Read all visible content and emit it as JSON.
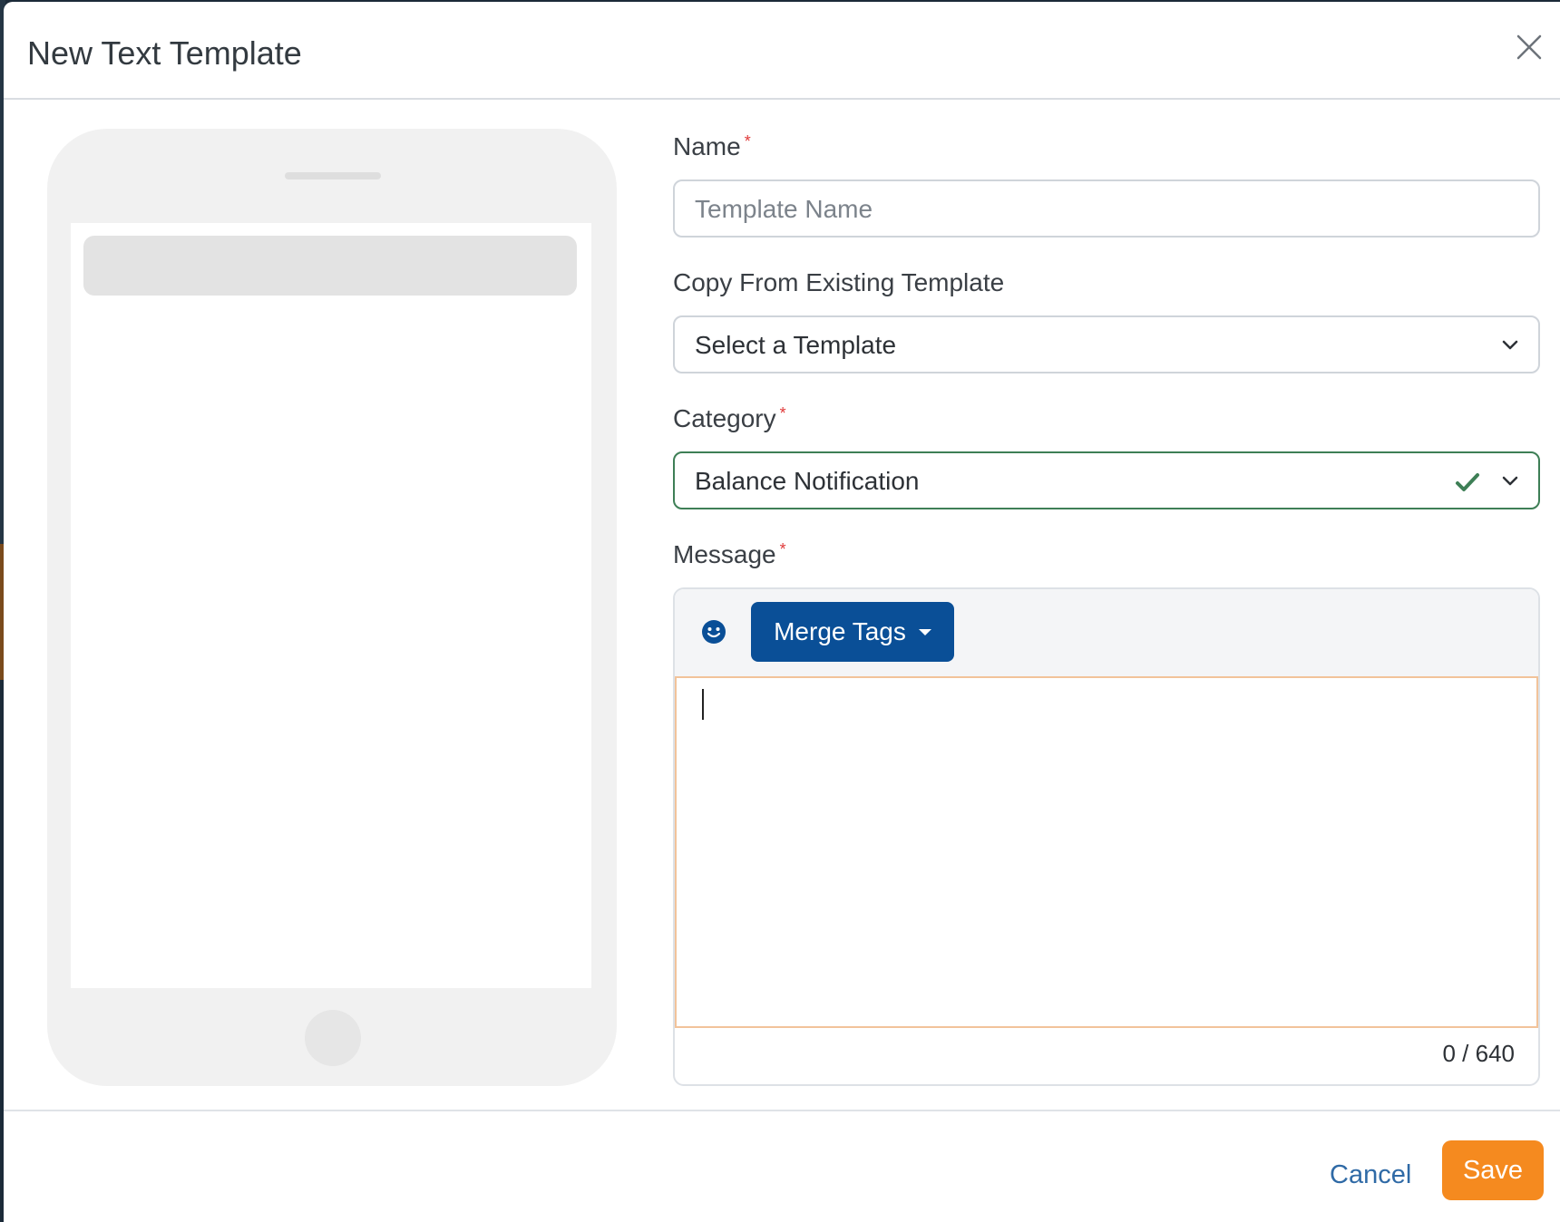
{
  "modal": {
    "title": "New Text Template"
  },
  "form": {
    "name": {
      "label": "Name",
      "required_mark": "*",
      "placeholder": "Template Name",
      "value": ""
    },
    "copy_from": {
      "label": "Copy From Existing Template",
      "selected": "Select a Template"
    },
    "category": {
      "label": "Category",
      "required_mark": "*",
      "selected": "Balance Notification",
      "status": "valid"
    },
    "message": {
      "label": "Message",
      "required_mark": "*",
      "merge_tags_label": "Merge Tags",
      "value": "",
      "counter": "0 / 640"
    }
  },
  "footer": {
    "cancel_label": "Cancel",
    "save_label": "Save"
  },
  "colors": {
    "primary_button": "#0a4f97",
    "save_button": "#f58a1f",
    "cancel_link": "#2f6aa6",
    "valid": "#3e7f56",
    "required": "#e03a3a",
    "focus_border": "#f2c39a"
  },
  "icons": [
    "close-icon",
    "chevron-down-icon",
    "check-icon",
    "emoji-icon",
    "caret-down-icon"
  ]
}
